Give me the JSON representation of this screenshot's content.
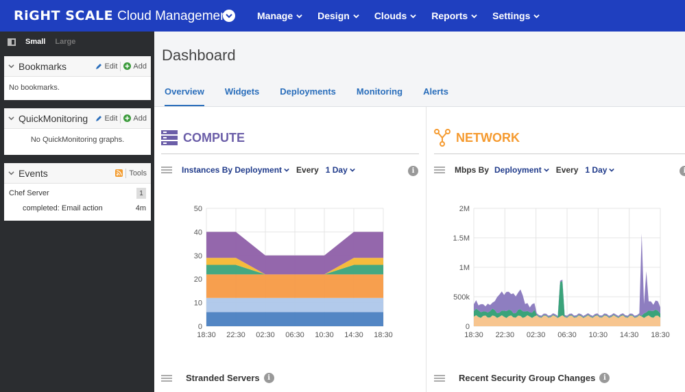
{
  "header": {
    "brand_logo": "RiGHT SCALE",
    "brand_sub": "Cloud Management",
    "nav": [
      "Manage",
      "Design",
      "Clouds",
      "Reports",
      "Settings"
    ]
  },
  "sidebar": {
    "size_small": "Small",
    "size_large": "Large",
    "bookmarks": {
      "title": "Bookmarks",
      "edit": "Edit",
      "add": "Add",
      "empty": "No bookmarks."
    },
    "quickmon": {
      "title": "QuickMonitoring",
      "edit": "Edit",
      "add": "Add",
      "empty": "No QuickMonitoring graphs."
    },
    "events": {
      "title": "Events",
      "tools": "Tools",
      "item_title": "Chef Server",
      "item_count": "1",
      "item_detail": "completed: Email action",
      "item_age": "4m"
    }
  },
  "main": {
    "title": "Dashboard",
    "tabs": [
      "Overview",
      "Widgets",
      "Deployments",
      "Monitoring",
      "Alerts"
    ],
    "compute": {
      "title": "COMPUTE",
      "ctrl_label": "Instances By Deployment",
      "every": "Every",
      "period": "1 Day",
      "bottom": "Stranded Servers"
    },
    "network": {
      "title": "NETWORK",
      "ctrl_prefix": "Mbps By",
      "ctrl_label": "Deployment",
      "every": "Every",
      "period": "1 Day",
      "bottom": "Recent Security Group Changes"
    }
  },
  "colors": {
    "accent": "#1f3fbf",
    "compute": "#6b5ea8",
    "network": "#f59a2f"
  },
  "chart_data": [
    {
      "type": "area",
      "stacked": true,
      "x": [
        "18:30",
        "22:30",
        "02:30",
        "06:30",
        "10:30",
        "14:30",
        "18:30"
      ],
      "ylim": [
        0,
        50
      ],
      "yticks": [
        0,
        10,
        20,
        30,
        40,
        50
      ],
      "grid": true,
      "series_colors": [
        "#4a7fc1",
        "#aec7ea",
        "#f79a45",
        "#3aa37a",
        "#f5b731",
        "#8e5fa8"
      ],
      "series": [
        {
          "values": [
            6,
            6,
            6,
            6,
            6,
            6,
            6
          ]
        },
        {
          "values": [
            6,
            6,
            6,
            6,
            6,
            6,
            6
          ]
        },
        {
          "values": [
            10,
            10,
            10,
            10,
            10,
            10,
            10
          ]
        },
        {
          "values": [
            4,
            4,
            0,
            0,
            0,
            4,
            4
          ]
        },
        {
          "values": [
            3,
            3,
            0,
            0,
            0,
            3,
            3
          ]
        },
        {
          "values": [
            11,
            11,
            8,
            8,
            8,
            11,
            11
          ]
        }
      ]
    },
    {
      "type": "area",
      "stacked": true,
      "x": [
        "18:30",
        "22:30",
        "02:30",
        "06:30",
        "10:30",
        "14:30",
        "18:30"
      ],
      "yticks": [
        "0",
        "500k",
        "1M",
        "1.5M",
        "2M"
      ],
      "ylim": [
        0,
        2000000
      ],
      "grid": true,
      "series_colors": [
        "#f7c58f",
        "#3aa37a",
        "#8e7ec0"
      ]
    }
  ]
}
